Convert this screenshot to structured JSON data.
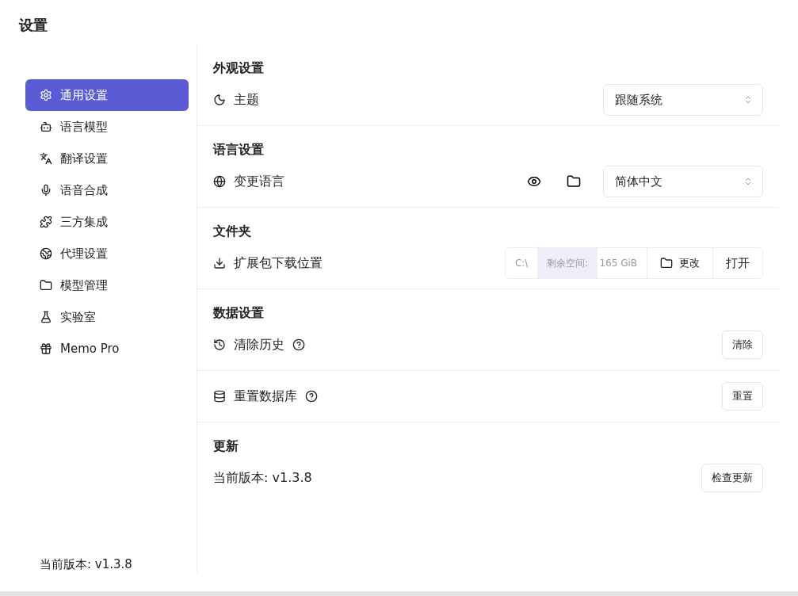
{
  "window": {
    "title": "设置"
  },
  "sidebar": {
    "items": [
      {
        "label": "通用设置",
        "selected": true
      },
      {
        "label": "语言模型",
        "selected": false
      },
      {
        "label": "翻译设置",
        "selected": false
      },
      {
        "label": "语音合成",
        "selected": false
      },
      {
        "label": "三方集成",
        "selected": false
      },
      {
        "label": "代理设置",
        "selected": false
      },
      {
        "label": "模型管理",
        "selected": false
      },
      {
        "label": "实验室",
        "selected": false
      },
      {
        "label": "Memo Pro",
        "selected": false
      }
    ],
    "version": "当前版本: v1.3.8"
  },
  "sections": [
    {
      "title": "外观设置",
      "rows": [
        {
          "kind": "select",
          "label": "主题",
          "value": "跟随系统"
        }
      ]
    },
    {
      "title": "语言设置",
      "rows": [
        {
          "kind": "select-tools",
          "label": "变更语言",
          "value": "简体中文"
        }
      ]
    },
    {
      "title": "文件夹",
      "rows": [
        {
          "kind": "path",
          "label": "扩展包下载位置",
          "path": "C:\\",
          "space_label": "剩余空间:",
          "space": "165 GiB",
          "buttons": [
            "更改",
            "打开"
          ]
        }
      ]
    },
    {
      "title": "数据设置",
      "rows": [
        {
          "kind": "button",
          "label": "清除历史",
          "help": true,
          "button": "清除"
        },
        {
          "kind": "button",
          "label": "重置数据库",
          "help": true,
          "button": "重置"
        }
      ]
    },
    {
      "title": "更新",
      "rows": [
        {
          "kind": "button",
          "label": "当前版本: v1.3.8",
          "help": false,
          "button": "检查更新"
        }
      ]
    }
  ]
}
